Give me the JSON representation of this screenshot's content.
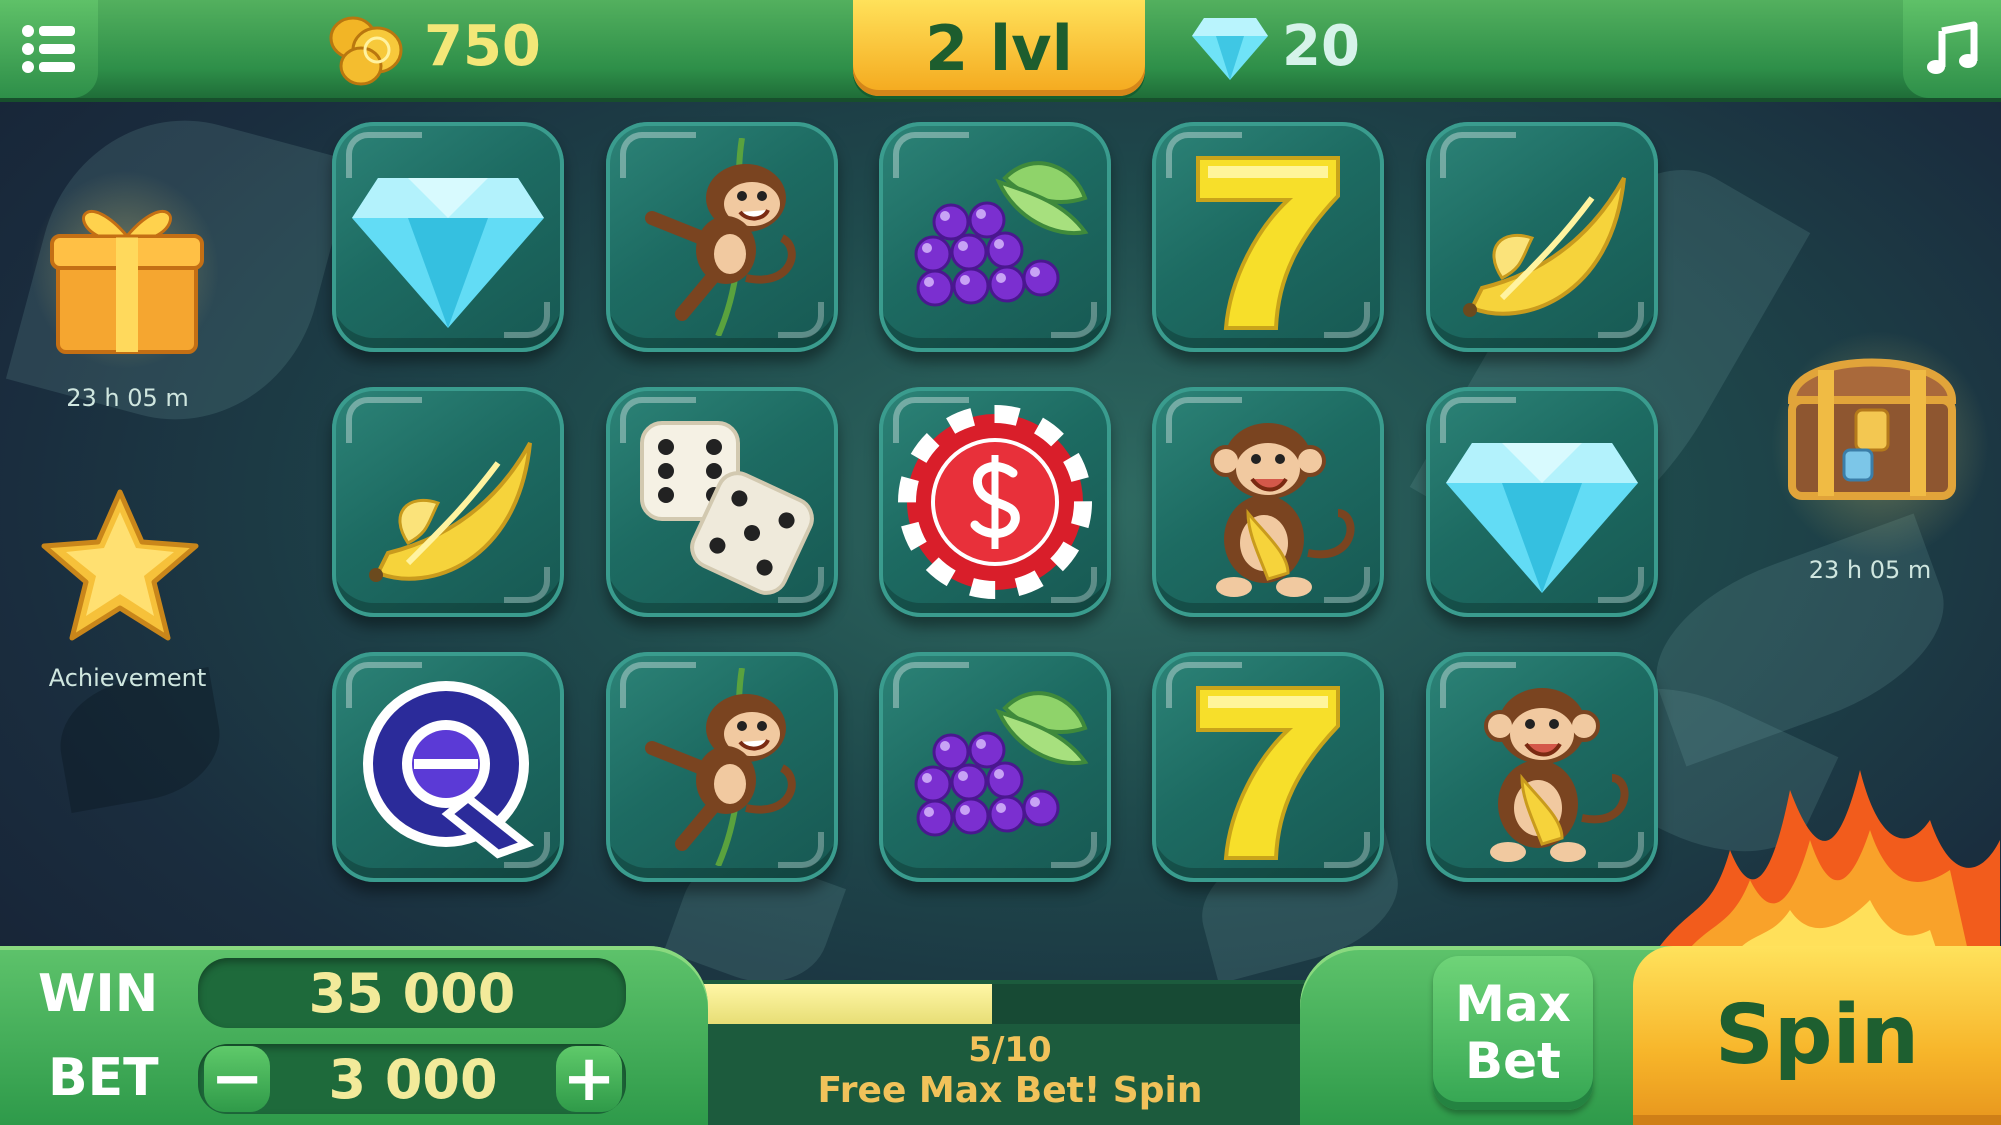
{
  "header": {
    "coins": "750",
    "level": "2 lvl",
    "gems": "20"
  },
  "side": {
    "gift_timer": "23 h  05 m",
    "achievement_label": "Achievement",
    "chest_timer": "23 h  05 m"
  },
  "reels": {
    "rows": [
      [
        "diamond",
        "monkey-vine",
        "grapes",
        "seven",
        "banana"
      ],
      [
        "banana",
        "dice",
        "casino-chip",
        "monkey-banana",
        "diamond"
      ],
      [
        "q-letter",
        "monkey-vine",
        "grapes",
        "seven",
        "monkey-banana"
      ]
    ]
  },
  "bottom": {
    "win_label": "WIN",
    "win_value": "35 000",
    "bet_label": "BET",
    "bet_value": "3 000",
    "minus_label": "−",
    "plus_label": "+",
    "progress_text": "5/10",
    "progress_fraction": 0.5,
    "free_text": "Free Max Bet! Spin",
    "maxbet_line1": "Max",
    "maxbet_line2": "Bet",
    "spin_label": "Spin"
  },
  "colors": {
    "accent_yellow": "#f4a81d",
    "dark_green": "#1d5d2e",
    "tile_teal": "#1d6b62"
  }
}
